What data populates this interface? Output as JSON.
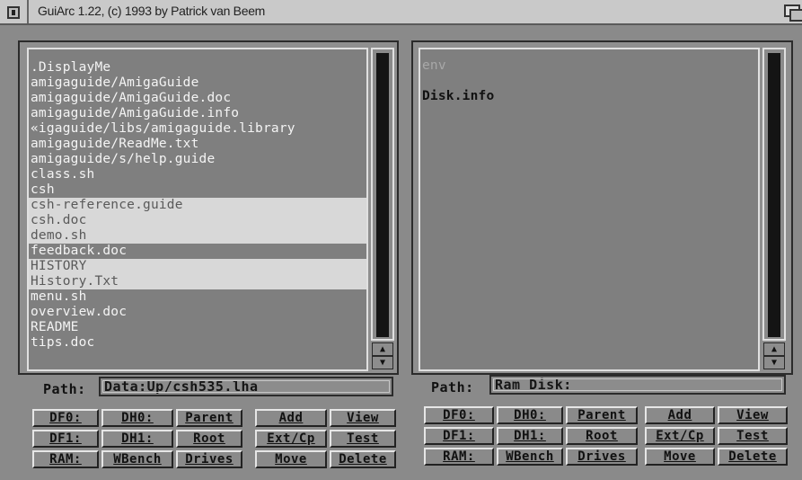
{
  "window": {
    "title": "GuiArc 1.22, (c) 1993 by Patrick van Beem"
  },
  "left": {
    "files": [
      ".DisplayMe",
      "amigaguide/AmigaGuide",
      "amigaguide/AmigaGuide.doc",
      "amigaguide/AmigaGuide.info",
      "«igaguide/libs/amigaguide.library",
      "amigaguide/ReadMe.txt",
      "amigaguide/s/help.guide",
      "class.sh",
      "csh",
      "csh-reference.guide",
      "csh.doc",
      "demo.sh",
      "feedback.doc",
      "HISTORY",
      "History.Txt",
      "menu.sh",
      "overview.doc",
      "README",
      "tips.doc"
    ],
    "path_label": "Path:",
    "path_value": "Data:Up/csh535.lha",
    "buttons": {
      "df0": "DF0:",
      "dh0": "DH0:",
      "parent": "Parent",
      "add": "Add",
      "view": "View",
      "df1": "DF1:",
      "dh1": "DH1:",
      "root": "Root",
      "extcp": "Ext/Cp",
      "test": "Test",
      "ram": "RAM:",
      "wbench": "WBench",
      "drives": "Drives",
      "move": "Move",
      "delete": "Delete"
    }
  },
  "right": {
    "files": [
      "env",
      "Disk.info"
    ],
    "path_label": "Path:",
    "path_value": "Ram Disk:",
    "buttons": {
      "df0": "DF0:",
      "dh0": "DH0:",
      "parent": "Parent",
      "add": "Add",
      "view": "View",
      "df1": "DF1:",
      "dh1": "DH1:",
      "root": "Root",
      "extcp": "Ext/Cp",
      "test": "Test",
      "ram": "RAM:",
      "wbench": "WBench",
      "drives": "Drives",
      "move": "Move",
      "delete": "Delete"
    }
  },
  "icons": {
    "close": "close-gadget-icon",
    "depth": "depth-gadget-icon",
    "up": "arrow-up-icon",
    "down": "arrow-down-icon"
  },
  "colors": {
    "background": "#8a8a8a",
    "selection": "#d8d8d8",
    "text_light": "#f4f4f4",
    "text_dark": "#111111"
  }
}
